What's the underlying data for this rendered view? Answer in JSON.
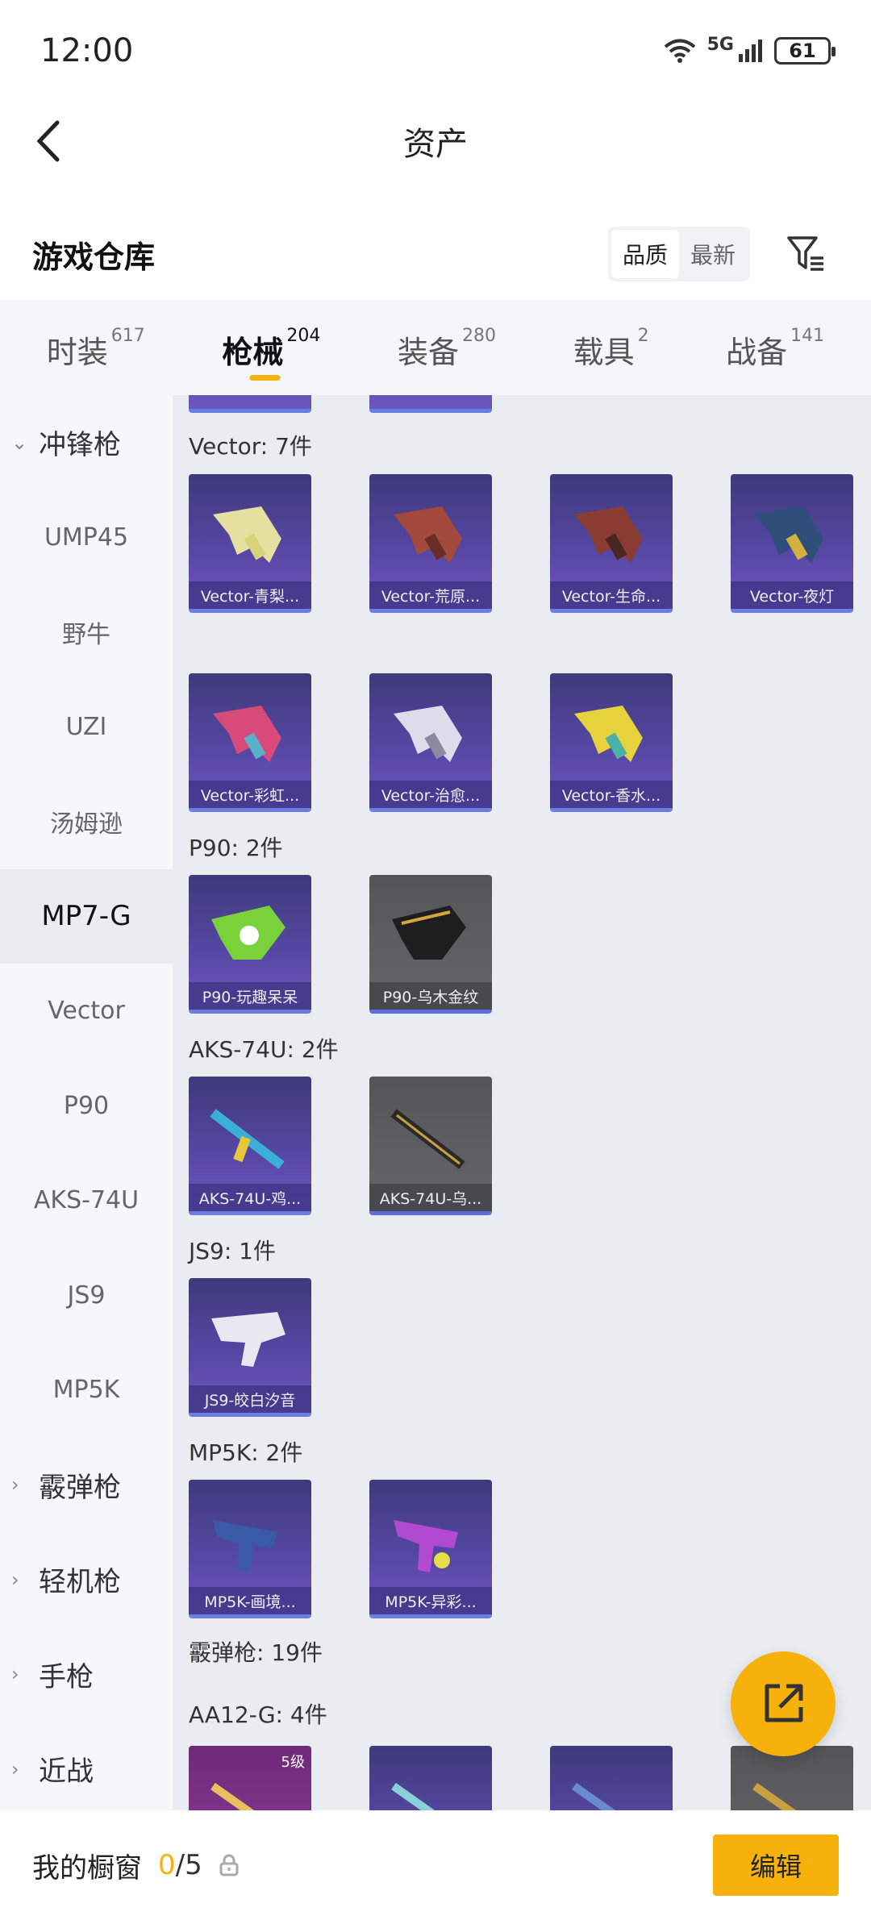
{
  "status": {
    "time": "12:00",
    "network": "5G",
    "battery": "61"
  },
  "nav": {
    "title": "资产"
  },
  "section": {
    "title": "游戏仓库",
    "sort_options": [
      "品质",
      "最新"
    ]
  },
  "tabs": [
    {
      "label": "时装",
      "count": "617"
    },
    {
      "label": "枪械",
      "count": "204"
    },
    {
      "label": "装备",
      "count": "280"
    },
    {
      "label": "载具",
      "count": "2"
    },
    {
      "label": "战备",
      "count": "141"
    }
  ],
  "sidebar": {
    "items": [
      {
        "label": "冲锋枪",
        "chev": "⌄"
      },
      {
        "label": "UMP45"
      },
      {
        "label": "野牛"
      },
      {
        "label": "UZI"
      },
      {
        "label": "汤姆逊"
      },
      {
        "label": "MP7-G"
      },
      {
        "label": "Vector"
      },
      {
        "label": "P90"
      },
      {
        "label": "AKS-74U"
      },
      {
        "label": "JS9"
      },
      {
        "label": "MP5K"
      },
      {
        "label": "霰弹枪",
        "chev": "›"
      },
      {
        "label": "轻机枪",
        "chev": "›"
      },
      {
        "label": "手枪",
        "chev": "›"
      },
      {
        "label": "近战",
        "chev": "›"
      }
    ]
  },
  "content": {
    "groups": {
      "vector": "Vector: 7件",
      "p90": "P90: 2件",
      "aks": "AKS-74U: 2件",
      "js9": "JS9: 1件",
      "mp5k": "MP5K: 2件",
      "shotgun": "霰弹枪: 19件",
      "aa12": "AA12-G: 4件"
    },
    "cards": {
      "v1": "Vector-青梨...",
      "v2": "Vector-荒原...",
      "v3": "Vector-生命...",
      "v4": "Vector-夜灯",
      "v5": "Vector-彩虹...",
      "v6": "Vector-治愈...",
      "v7": "Vector-香水...",
      "p1": "P90-玩趣呆呆",
      "p2": "P90-乌木金纹",
      "a1": "AKS-74U-鸡...",
      "a2": "AKS-74U-乌...",
      "j1": "JS9-皎白汐音",
      "m1": "MP5K-画境...",
      "m2": "MP5K-异彩..."
    },
    "aa12_level": "5级"
  },
  "bottom": {
    "label": "我的橱窗",
    "current": "0",
    "total": "/5",
    "edit": "编辑"
  },
  "colors": {
    "accent": "#f6b10a",
    "card_purple": "#5848a6",
    "card_grey": "#5f5f63"
  }
}
